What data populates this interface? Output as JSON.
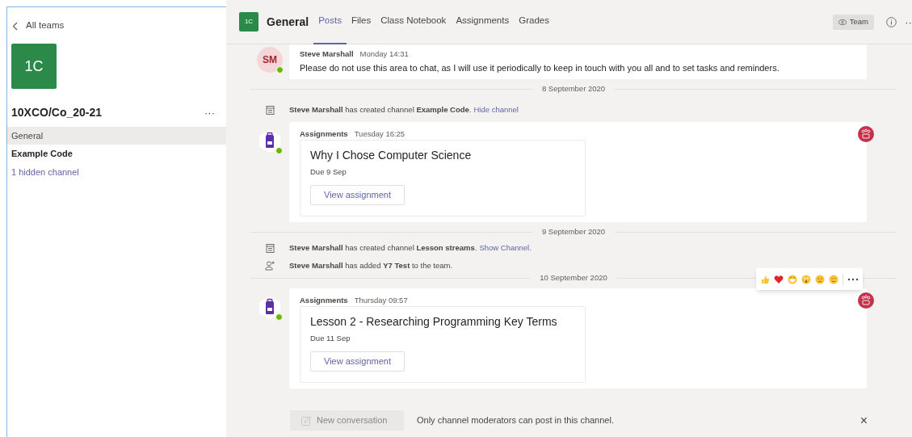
{
  "sidebar": {
    "back_label": "All teams",
    "team_tile": "1C",
    "team_name": "10XCO/Co_20-21",
    "more": "···",
    "channels": [
      {
        "label": "General",
        "selected": true,
        "unread": false
      },
      {
        "label": "Example Code",
        "selected": false,
        "unread": true
      }
    ],
    "hidden_link": "1 hidden channel"
  },
  "header": {
    "tile": "1C",
    "channel": "General",
    "tabs": [
      {
        "label": "Posts",
        "selected": true
      },
      {
        "label": "Files",
        "selected": false
      },
      {
        "label": "Class Notebook",
        "selected": false
      },
      {
        "label": "Assignments",
        "selected": false
      },
      {
        "label": "Grades",
        "selected": false
      }
    ],
    "team_button": "Team",
    "more": "··"
  },
  "feed": [
    {
      "kind": "message",
      "initials": "SM",
      "online": true,
      "author": "Steve Marshall",
      "time": "Monday 14:31",
      "text": "Please do not use this area to chat, as I will use it periodically to keep in touch with you all and to set tasks and reminders."
    },
    {
      "kind": "date",
      "text": "8 September 2020"
    },
    {
      "kind": "channel-event",
      "text": "**Steve Marshall** has created channel **Example Code**.",
      "link": "Hide channel"
    },
    {
      "kind": "assignment",
      "online": true,
      "author": "Assignments",
      "time": "Tuesday 16:25",
      "title": "Why I Chose Computer Science",
      "due": "Due 9 Sep",
      "button": "View assignment"
    },
    {
      "kind": "date",
      "text": "9 September 2020"
    },
    {
      "kind": "channel-event",
      "text": "**Steve Marshall** has created channel **Lesson streams**.",
      "link": "Show Channel."
    },
    {
      "kind": "member-event",
      "text": "**Steve Marshall** has added **Y7 Test** to the team."
    },
    {
      "kind": "date",
      "text": "10 September 2020"
    },
    {
      "kind": "assignment",
      "online": true,
      "author": "Assignments",
      "time": "Thursday 09:57",
      "title": "Lesson 2 - Researching Programming Key Terms",
      "due": "Due 11 Sep",
      "button": "View assignment"
    }
  ],
  "footer": {
    "new_conversation": "New conversation",
    "new_conversation_disabled": true,
    "notice": "Only channel moderators can post in this channel.",
    "close": "×"
  }
}
